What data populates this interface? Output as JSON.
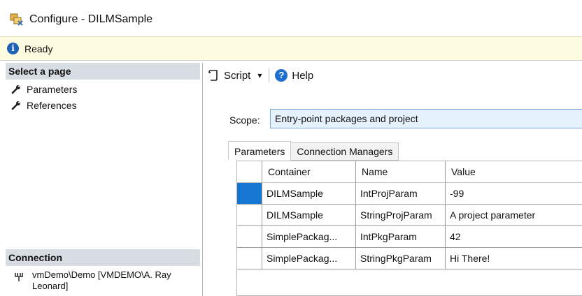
{
  "window": {
    "title": "Configure - DILMSample",
    "icon": "configure-icon"
  },
  "status": {
    "icon": "info-icon",
    "text": "Ready"
  },
  "left_pane": {
    "select_page_header": "Select a page",
    "pages": [
      {
        "label": "Parameters",
        "icon": "wrench-icon"
      },
      {
        "label": "References",
        "icon": "wrench-icon"
      }
    ],
    "connection_header": "Connection",
    "connection": {
      "icon": "server-connection-icon",
      "text": "vmDemo\\Demo [VMDEMO\\A. Ray Leonard]"
    }
  },
  "toolbar": {
    "script_label": "Script",
    "script_dropdown_glyph": "▾",
    "help_label": "Help"
  },
  "scope": {
    "label": "Scope:",
    "value": "Entry-point packages and project"
  },
  "tabs": [
    {
      "label": "Parameters",
      "active": true
    },
    {
      "label": "Connection Managers",
      "active": false
    }
  ],
  "grid": {
    "columns": [
      "Container",
      "Name",
      "Value"
    ],
    "rows": [
      {
        "container": "DILMSample",
        "name": "IntProjParam",
        "value": "-99",
        "selected": true
      },
      {
        "container": "DILMSample",
        "name": "StringProjParam",
        "value": "A project parameter",
        "selected": false
      },
      {
        "container": "SimplePackag...",
        "name": "IntPkgParam",
        "value": "42",
        "selected": false
      },
      {
        "container": "SimplePackag...",
        "name": "StringPkgParam",
        "value": "Hi There!",
        "selected": false
      }
    ]
  },
  "colors": {
    "selection": "#1577d2",
    "status_bg": "#fdfce0",
    "section_header_bg": "#d8dde3",
    "scope_bg": "#e5f1fb"
  }
}
